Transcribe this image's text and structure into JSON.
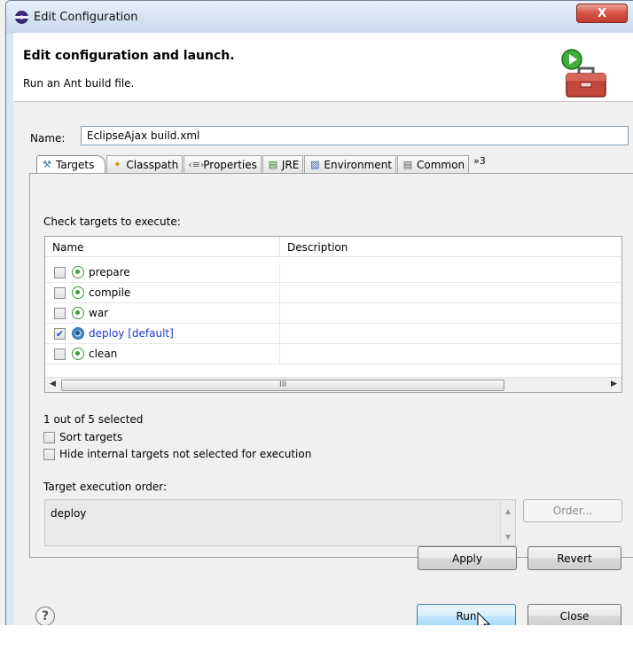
{
  "window": {
    "title": "Edit Configuration",
    "close_glyph": "X",
    "app_icon": "eclipse-icon"
  },
  "header": {
    "title": "Edit configuration and launch.",
    "subtitle": "Run an Ant build file.",
    "icon": "ant-run-toolbox-icon"
  },
  "name_field": {
    "label": "Name:",
    "value": "EclipseAjax build.xml"
  },
  "tabs": [
    {
      "label": "Targets",
      "icon": "targets-icon",
      "active": true
    },
    {
      "label": "Classpath",
      "icon": "classpath-icon",
      "active": false
    },
    {
      "label": "Properties",
      "icon": "properties-icon",
      "active": false
    },
    {
      "label": "JRE",
      "icon": "jre-icon",
      "active": false
    },
    {
      "label": "Environment",
      "icon": "environment-icon",
      "active": false
    },
    {
      "label": "Common",
      "icon": "common-icon",
      "active": false
    }
  ],
  "tabs_overflow": "»3",
  "targets_panel": {
    "check_label": "Check targets to execute:",
    "columns": [
      "Name",
      "Description"
    ],
    "rows": [
      {
        "name": "prepare",
        "description": "",
        "checked": false,
        "default": false
      },
      {
        "name": "compile",
        "description": "",
        "checked": false,
        "default": false
      },
      {
        "name": "war",
        "description": "",
        "checked": false,
        "default": false
      },
      {
        "name": "deploy [default]",
        "description": "",
        "checked": true,
        "default": true
      },
      {
        "name": "clean",
        "description": "",
        "checked": false,
        "default": false
      }
    ],
    "scroll_thumb_glyph": "III",
    "selected_count": "1 out of 5 selected",
    "sort_targets_label": "Sort targets",
    "hide_internal_label": "Hide internal targets not selected for execution",
    "order_label": "Target execution order:",
    "order_value": "deploy",
    "order_button": "Order..."
  },
  "buttons": {
    "apply": "Apply",
    "revert": "Revert",
    "run": "Run",
    "close": "Close",
    "help_glyph": "?"
  },
  "colors": {
    "default_target_text": "#1a3ad0",
    "title_bar": "#d5e2f3",
    "close_button": "#c03a2c"
  }
}
